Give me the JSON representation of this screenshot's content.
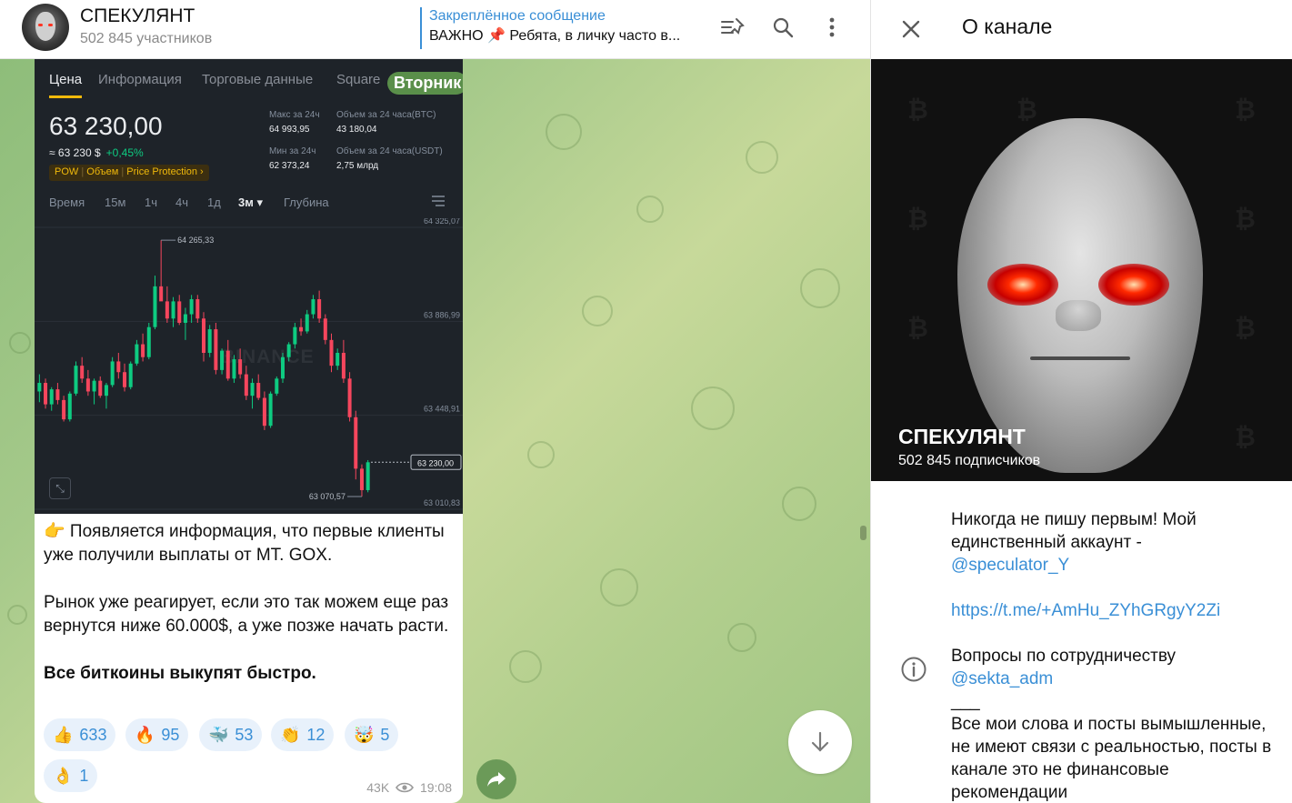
{
  "header": {
    "channel_name": "СПЕКУЛЯНТ",
    "members": "502 845 участников",
    "pinned_title": "Закреплённое сообщение",
    "pinned_text": "ВАЖНО 📌 Ребята, в личку часто в...",
    "icons": [
      "pinned-list-icon",
      "search-icon",
      "more-vertical-icon"
    ]
  },
  "screenshot": {
    "tabs": [
      "Цена",
      "Информация",
      "Торговые данные",
      "Square"
    ],
    "day_badge": "Вторник",
    "price": "63 230,00",
    "price_usd": "≈ 63 230 $",
    "price_change": "+0,45%",
    "tags": [
      "POW",
      "Объем",
      "Price Protection ›"
    ],
    "stats": {
      "max24_label": "Макс за 24ч",
      "max24_value": "64 993,95",
      "vol_btc_label": "Объем за 24 часа(BTC)",
      "vol_btc_value": "43 180,04",
      "min24_label": "Мин за 24ч",
      "min24_value": "62 373,24",
      "vol_usdt_label": "Объем за 24 часа(USDT)",
      "vol_usdt_value": "2,75 млрд"
    },
    "timeframes": [
      "Время",
      "15м",
      "1ч",
      "4ч",
      "1д",
      "3м ▾",
      "Глубина"
    ],
    "watermark": "BINANCE",
    "chart_data": {
      "type": "candlestick",
      "y_ticks": [
        "64 325,07",
        "63 886,99",
        "63 448,91",
        "63 010,83"
      ],
      "ylim": [
        63010.83,
        64325.07
      ],
      "high_label": "64 265,33",
      "low_label": "63 070,57",
      "last_price_label": "63 230,00",
      "colors": {
        "up": "#0ecb81",
        "down": "#f6465d"
      },
      "ohlc": [
        [
          63560,
          63640,
          63510,
          63600
        ],
        [
          63600,
          63620,
          63480,
          63500
        ],
        [
          63500,
          63580,
          63470,
          63570
        ],
        [
          63570,
          63600,
          63500,
          63520
        ],
        [
          63520,
          63540,
          63420,
          63430
        ],
        [
          63430,
          63560,
          63420,
          63550
        ],
        [
          63550,
          63700,
          63540,
          63680
        ],
        [
          63680,
          63720,
          63600,
          63620
        ],
        [
          63620,
          63660,
          63540,
          63560
        ],
        [
          63560,
          63620,
          63500,
          63610
        ],
        [
          63610,
          63630,
          63530,
          63540
        ],
        [
          63540,
          63600,
          63480,
          63590
        ],
        [
          63590,
          63720,
          63580,
          63700
        ],
        [
          63700,
          63740,
          63620,
          63650
        ],
        [
          63650,
          63690,
          63560,
          63580
        ],
        [
          63580,
          63700,
          63570,
          63690
        ],
        [
          63690,
          63800,
          63680,
          63780
        ],
        [
          63780,
          63830,
          63700,
          63720
        ],
        [
          63720,
          63880,
          63710,
          63860
        ],
        [
          63860,
          64100,
          63850,
          64050
        ],
        [
          64050,
          64265,
          64000,
          63980
        ],
        [
          63980,
          64050,
          63880,
          63900
        ],
        [
          63900,
          64000,
          63860,
          63980
        ],
        [
          63980,
          64010,
          63870,
          63880
        ],
        [
          63880,
          63950,
          63800,
          63920
        ],
        [
          63920,
          64010,
          63880,
          63990
        ],
        [
          63990,
          64010,
          63880,
          63900
        ],
        [
          63900,
          63930,
          63700,
          63740
        ],
        [
          63740,
          63870,
          63720,
          63850
        ],
        [
          63850,
          63880,
          63640,
          63660
        ],
        [
          63660,
          63760,
          63640,
          63750
        ],
        [
          63750,
          63800,
          63610,
          63620
        ],
        [
          63620,
          63730,
          63600,
          63710
        ],
        [
          63710,
          63760,
          63620,
          63640
        ],
        [
          63640,
          63680,
          63520,
          63540
        ],
        [
          63540,
          63620,
          63480,
          63600
        ],
        [
          63600,
          63640,
          63520,
          63530
        ],
        [
          63530,
          63560,
          63380,
          63400
        ],
        [
          63400,
          63560,
          63390,
          63550
        ],
        [
          63550,
          63630,
          63540,
          63620
        ],
        [
          63620,
          63740,
          63600,
          63720
        ],
        [
          63720,
          63790,
          63700,
          63780
        ],
        [
          63780,
          63880,
          63760,
          63860
        ],
        [
          63860,
          63900,
          63820,
          63840
        ],
        [
          63840,
          63940,
          63830,
          63920
        ],
        [
          63920,
          64010,
          63900,
          63990
        ],
        [
          63990,
          64030,
          63880,
          63900
        ],
        [
          63900,
          63920,
          63780,
          63800
        ],
        [
          63800,
          63830,
          63650,
          63680
        ],
        [
          63680,
          63760,
          63660,
          63740
        ],
        [
          63740,
          63800,
          63600,
          63620
        ],
        [
          63620,
          63650,
          63420,
          63440
        ],
        [
          63440,
          63470,
          63150,
          63200
        ],
        [
          63200,
          63220,
          63070,
          63100
        ],
        [
          63100,
          63240,
          63090,
          63230
        ]
      ]
    }
  },
  "message": {
    "paragraph1": "👉 Появляется информация, что первые клиенты уже получили выплаты от MT. GOX.",
    "paragraph2": "Рынок уже реагирует, если это так можем еще раз вернутся ниже 60.000$, а уже позже начать расти.",
    "paragraph3": "Все биткоины выкупят быстро.",
    "reactions": [
      {
        "emoji": "👍",
        "count": "633"
      },
      {
        "emoji": "🔥",
        "count": "95"
      },
      {
        "emoji": "🐳",
        "count": "53"
      },
      {
        "emoji": "👏",
        "count": "12"
      },
      {
        "emoji": "🤯",
        "count": "5"
      },
      {
        "emoji": "👌",
        "count": "1"
      }
    ],
    "views": "43K",
    "time": "19:08"
  },
  "right_panel": {
    "title": "О канале",
    "channel_name": "СПЕКУЛЯНТ",
    "subscribers": "502 845 подписчиков",
    "description_line": "Никогда не пишу первым! Мой единственный аккаунт -",
    "account_link": "@speculator_Y",
    "invite_link": "https://t.me/+AmHu_ZYhGRgyY2Zi",
    "cooperation_text": "Вопросы по сотрудничеству",
    "cooperation_link": "@sekta_adm",
    "separator": "___",
    "disclaimer": "Все мои слова и посты вымышленные, не имеют связи с реальностью, посты в канале это не финансовые рекомендации"
  }
}
